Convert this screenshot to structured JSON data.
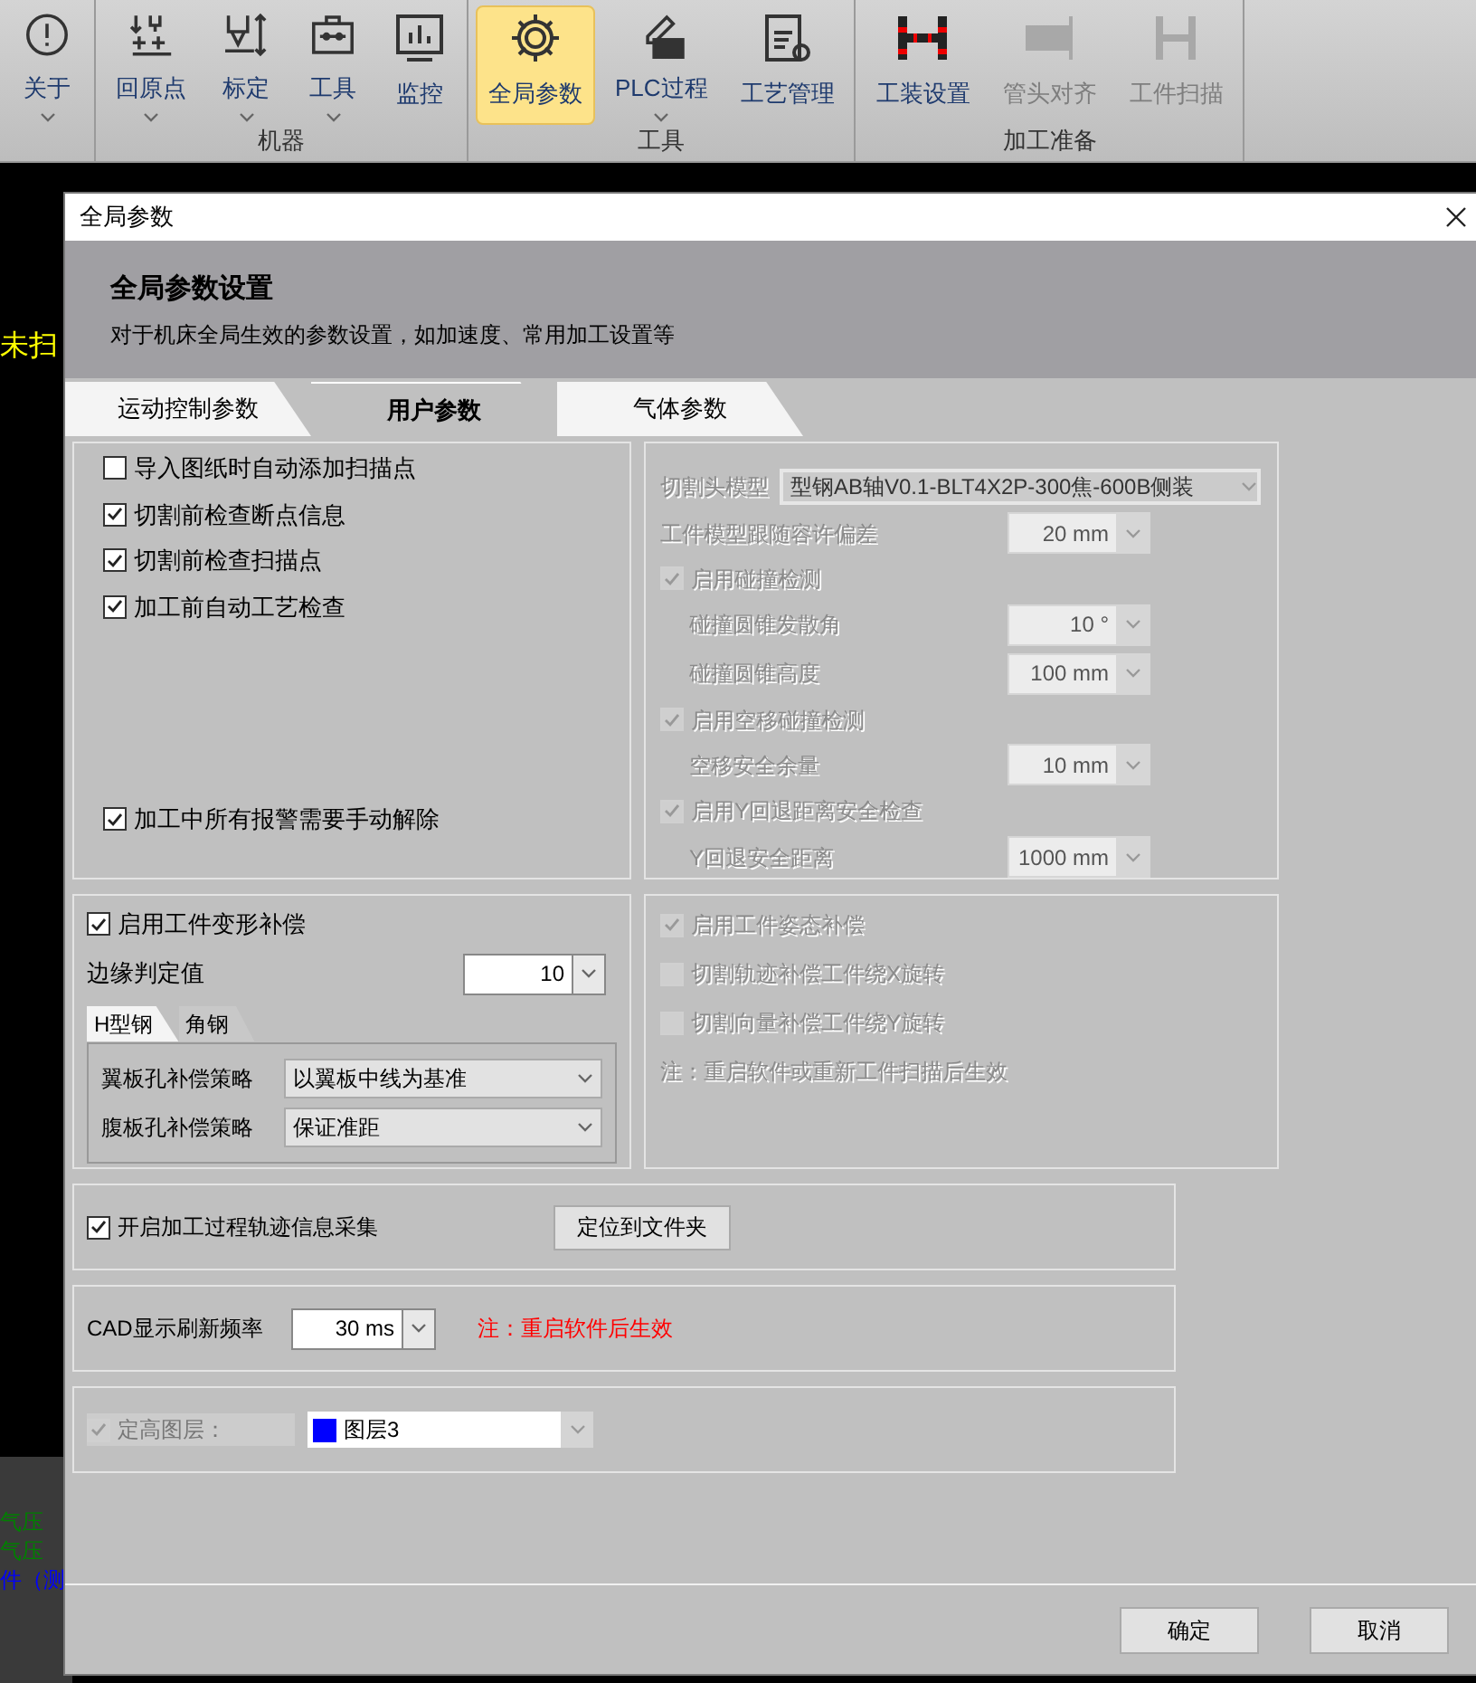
{
  "ribbon": {
    "groups": [
      {
        "items": [
          {
            "label": "关于",
            "selected": false,
            "disabled": false,
            "dropdown": true
          }
        ]
      },
      {
        "label": "机器",
        "items": [
          {
            "label": "回原点",
            "selected": false,
            "disabled": false,
            "dropdown": true
          },
          {
            "label": "标定",
            "selected": false,
            "disabled": false,
            "dropdown": true
          },
          {
            "label": "工具",
            "selected": false,
            "disabled": false,
            "dropdown": true
          },
          {
            "label": "监控",
            "selected": false,
            "disabled": false,
            "dropdown": false
          }
        ]
      },
      {
        "label": "工具",
        "items": [
          {
            "label": "全局参数",
            "selected": true,
            "disabled": false,
            "dropdown": false
          },
          {
            "label": "PLC过程",
            "selected": false,
            "disabled": false,
            "dropdown": true
          },
          {
            "label": "工艺管理",
            "selected": false,
            "disabled": false,
            "dropdown": false
          }
        ]
      },
      {
        "label": "加工准备",
        "items": [
          {
            "label": "工装设置",
            "selected": false,
            "disabled": false,
            "dropdown": false
          },
          {
            "label": "管头对齐",
            "selected": false,
            "disabled": true,
            "dropdown": false
          },
          {
            "label": "工件扫描",
            "selected": false,
            "disabled": true,
            "dropdown": false
          }
        ]
      }
    ]
  },
  "background": {
    "canvas_text": "未扫",
    "side_texts": [
      {
        "text": "气压",
        "color": "#008000"
      },
      {
        "text": "气压",
        "color": "#008000"
      },
      {
        "text": "件（测",
        "color": "#0000ff"
      }
    ]
  },
  "dialog": {
    "title": "全局参数",
    "header_title": "全局参数设置",
    "header_subtitle": "对于机床全局生效的参数设置，如加速度、常用加工设置等",
    "tabs": [
      {
        "label": "运动控制参数",
        "selected": false
      },
      {
        "label": "用户参数",
        "selected": true
      },
      {
        "label": "气体参数",
        "selected": false
      }
    ],
    "general_options": [
      {
        "label": "导入图纸时自动添加扫描点",
        "checked": false
      },
      {
        "label": "切割前检查断点信息",
        "checked": true
      },
      {
        "label": "切割前检查扫描点",
        "checked": true
      },
      {
        "label": "加工前自动工艺检查",
        "checked": true
      },
      {
        "label": "加工中所有报警需要手动解除",
        "checked": true
      }
    ],
    "cutting_head": {
      "disabled": true,
      "model_label": "切割头模型",
      "model_value": "型钢AB轴V0.1-BLT4X2P-300焦-600B侧装",
      "rows": [
        {
          "kind": "field",
          "label": "工件模型跟随容许偏差",
          "value": "20 mm",
          "indented": false
        },
        {
          "kind": "checkbox",
          "label": "启用碰撞检测",
          "checked": true
        },
        {
          "kind": "field",
          "label": "碰撞圆锥发散角",
          "value": "10 °",
          "indented": true
        },
        {
          "kind": "field",
          "label": "碰撞圆锥高度",
          "value": "100 mm",
          "indented": true
        },
        {
          "kind": "checkbox",
          "label": "启用空移碰撞检测",
          "checked": true
        },
        {
          "kind": "field",
          "label": "空移安全余量",
          "value": "10 mm",
          "indented": true
        },
        {
          "kind": "checkbox",
          "label": "启用Y回退距离安全检查",
          "checked": true
        },
        {
          "kind": "field",
          "label": "Y回退安全距离",
          "value": "1000 mm",
          "indented": true
        }
      ]
    },
    "deformation": {
      "label": "启用工件变形补偿",
      "checked": true,
      "edge_label": "边缘判定值",
      "edge_value": "10",
      "subtabs": [
        {
          "label": "H型钢",
          "selected": true
        },
        {
          "label": "角钢",
          "selected": false
        }
      ],
      "fields": [
        {
          "label": "翼板孔补偿策略",
          "value": "以翼板中线为基准"
        },
        {
          "label": "腹板孔补偿策略",
          "value": "保证准距"
        }
      ]
    },
    "posture": {
      "disabled": true,
      "options": [
        {
          "label": "启用工件姿态补偿",
          "checked": true
        },
        {
          "label": "切割轨迹补偿工件绕X旋转",
          "checked": false
        },
        {
          "label": "切割向量补偿工件绕Y旋转",
          "checked": false
        }
      ],
      "note": "注：重启软件或重新工件扫描后生效"
    },
    "trace": {
      "label": "开启加工过程轨迹信息采集",
      "checked": true,
      "button": "定位到文件夹"
    },
    "cad": {
      "label": "CAD显示刷新频率",
      "value": "30 ms",
      "note": "注：重启软件后生效"
    },
    "layer": {
      "label": "定高图层：",
      "checked": true,
      "disabled": true,
      "value": "图层3",
      "color": "#0000ff"
    },
    "buttons": [
      "确定",
      "取消"
    ]
  }
}
